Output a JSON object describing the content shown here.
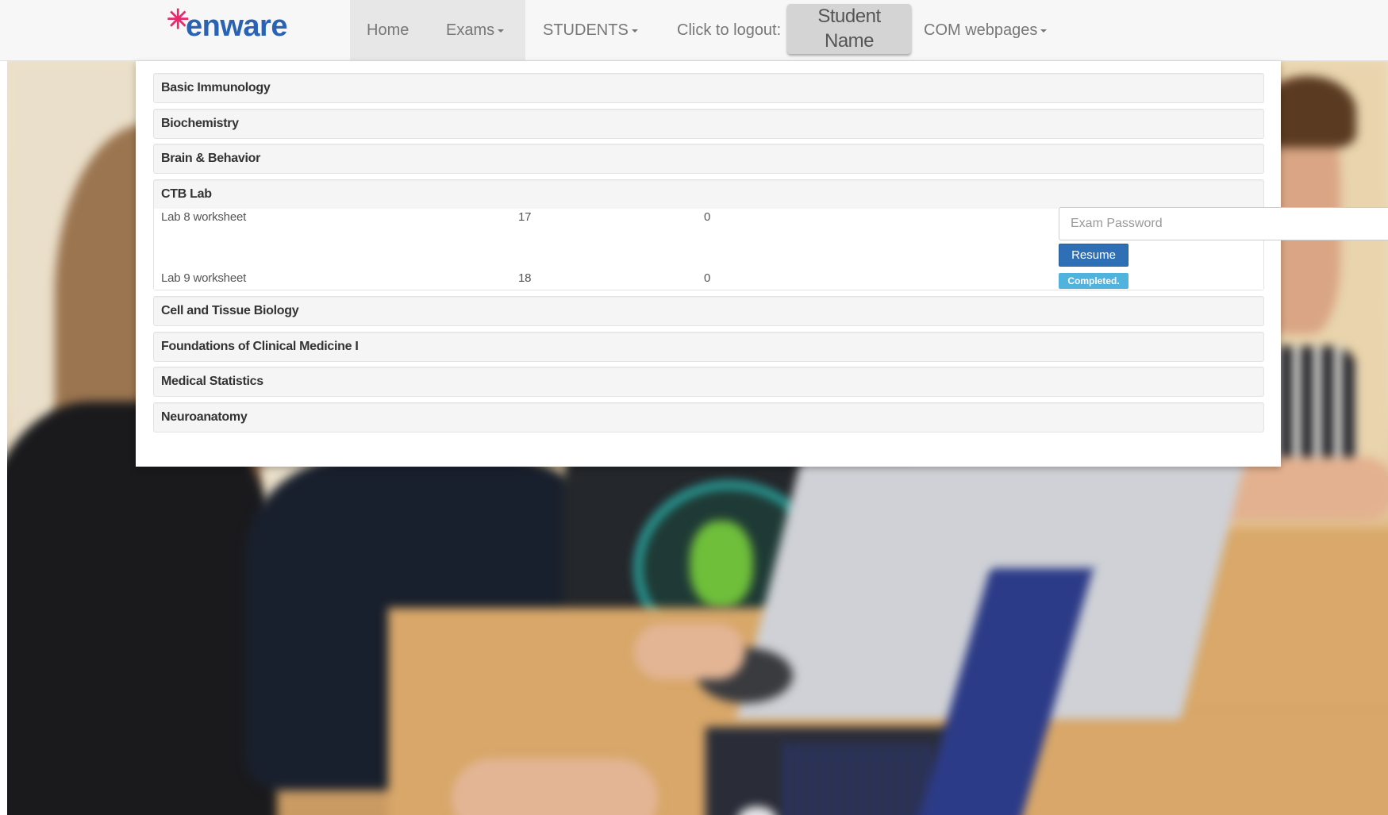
{
  "brand": {
    "name": "enware",
    "star": "✳"
  },
  "nav": {
    "home": "Home",
    "exams": "Exams",
    "students": "STUDENTS",
    "logout": "Click to logout:",
    "student_name_line1": "Student",
    "student_name_line2": "Name",
    "com_webpages": "COM webpages"
  },
  "courses": [
    "Basic Immunology",
    "Biochemistry",
    "Brain & Behavior",
    "CTB Lab",
    "Cell and Tissue Biology",
    "Foundations of Clinical Medicine I",
    "Medical Statistics",
    "Neuroanatomy"
  ],
  "ctb_exams": [
    {
      "name": "Lab 8 worksheet",
      "col2": "17",
      "col3": "0"
    },
    {
      "name": "Lab 9 worksheet",
      "col2": "18",
      "col3": "0"
    }
  ],
  "exam_password_placeholder": "Exam Password",
  "resume_label": "Resume",
  "completed_label": "Completed.",
  "colors": {
    "brand_blue": "#2a63b3",
    "brand_pink": "#e8296b",
    "button_blue": "#2f6fb5",
    "badge_blue": "#4fb3de"
  }
}
